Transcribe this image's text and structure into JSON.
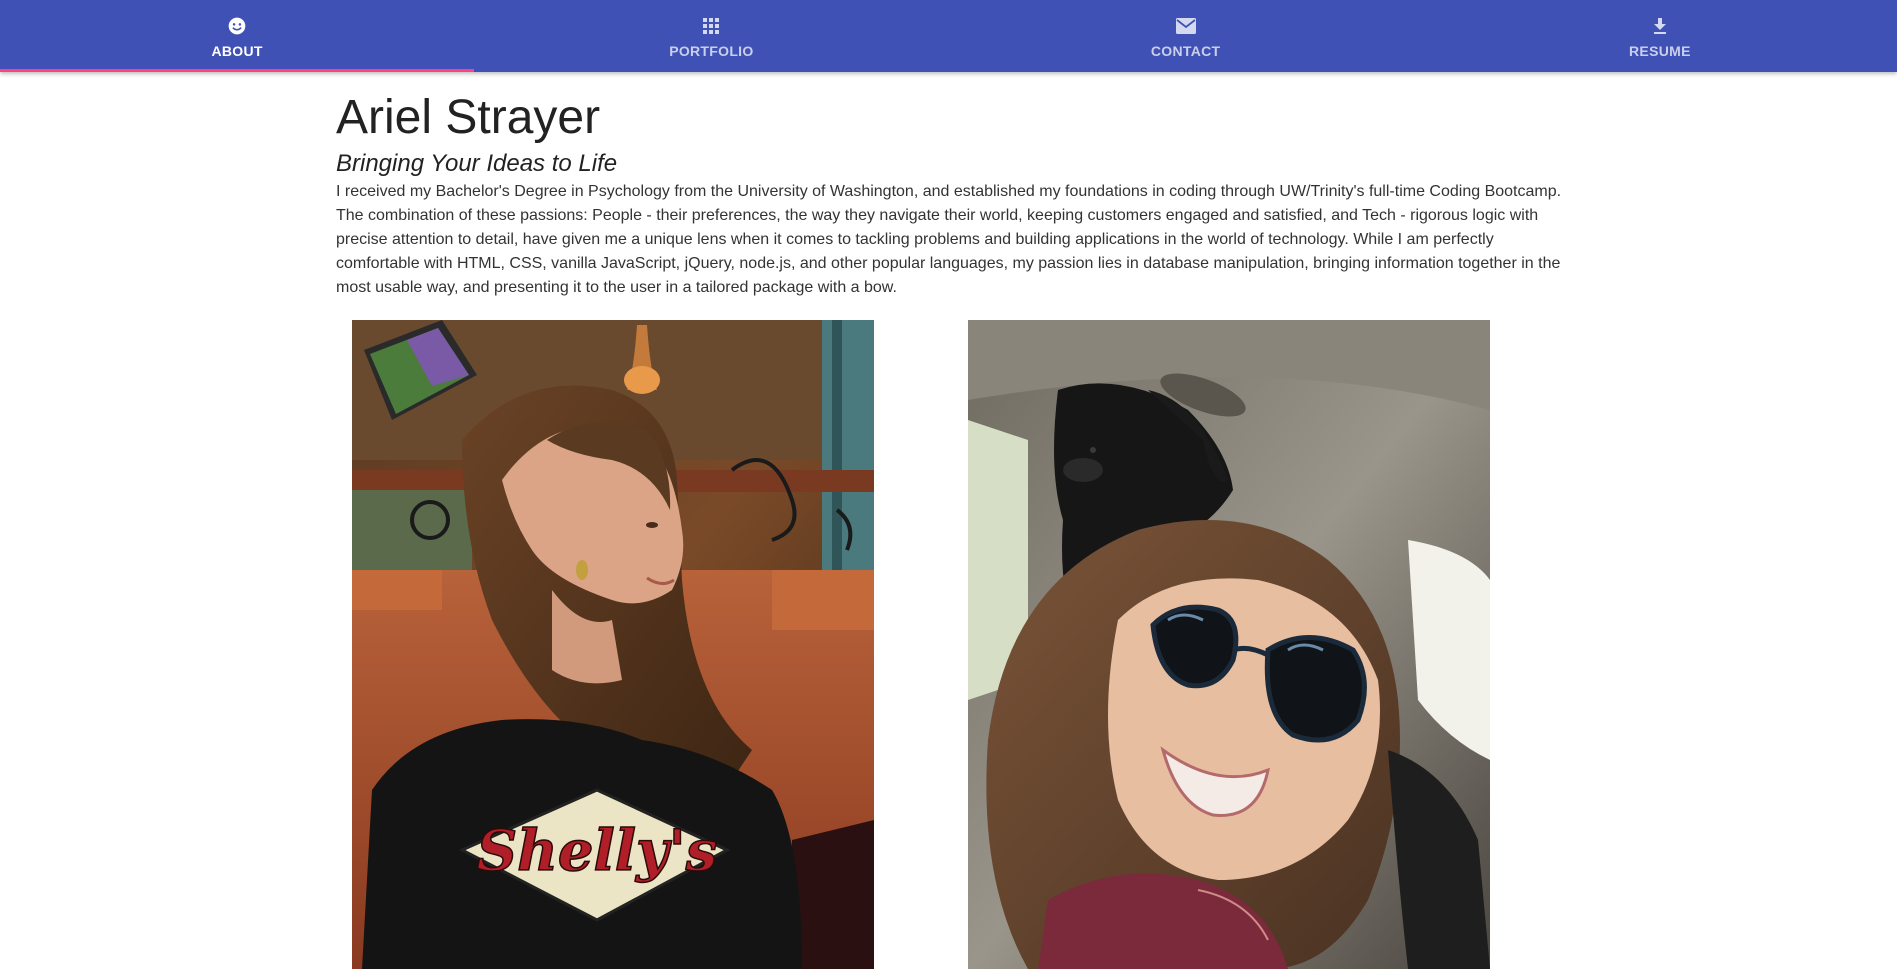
{
  "nav": {
    "tabs": [
      {
        "label": "ABOUT",
        "icon": "smiley-icon",
        "active": true
      },
      {
        "label": "PORTFOLIO",
        "icon": "grid-icon",
        "active": false
      },
      {
        "label": "CONTACT",
        "icon": "mail-icon",
        "active": false
      },
      {
        "label": "RESUME",
        "icon": "download-icon",
        "active": false
      }
    ],
    "colors": {
      "bar": "#3f51b5",
      "indicator": "#ff4081"
    }
  },
  "about": {
    "name": "Ariel Strayer",
    "tagline": "Bringing Your Ideas to Life",
    "bio": "I received my Bachelor's Degree in Psychology from the University of Washington, and established my foundations in coding through UW/Trinity's full-time Coding Bootcamp. The combination of these passions: People - their preferences, the way they navigate their world, keeping customers engaged and satisfied, and Tech - rigorous logic with precise attention to detail, have given me a unique lens when it comes to tackling problems and building applications in the world of technology. While I am perfectly comfortable with HTML, CSS, vanilla JavaScript, jQuery, node.js, and other popular languages, my passion lies in database manipulation, bringing information together in the most usable way, and presenting it to the user in a tailored package with a bow."
  },
  "photos": [
    {
      "shirt_text": "Shelly's"
    },
    {}
  ]
}
